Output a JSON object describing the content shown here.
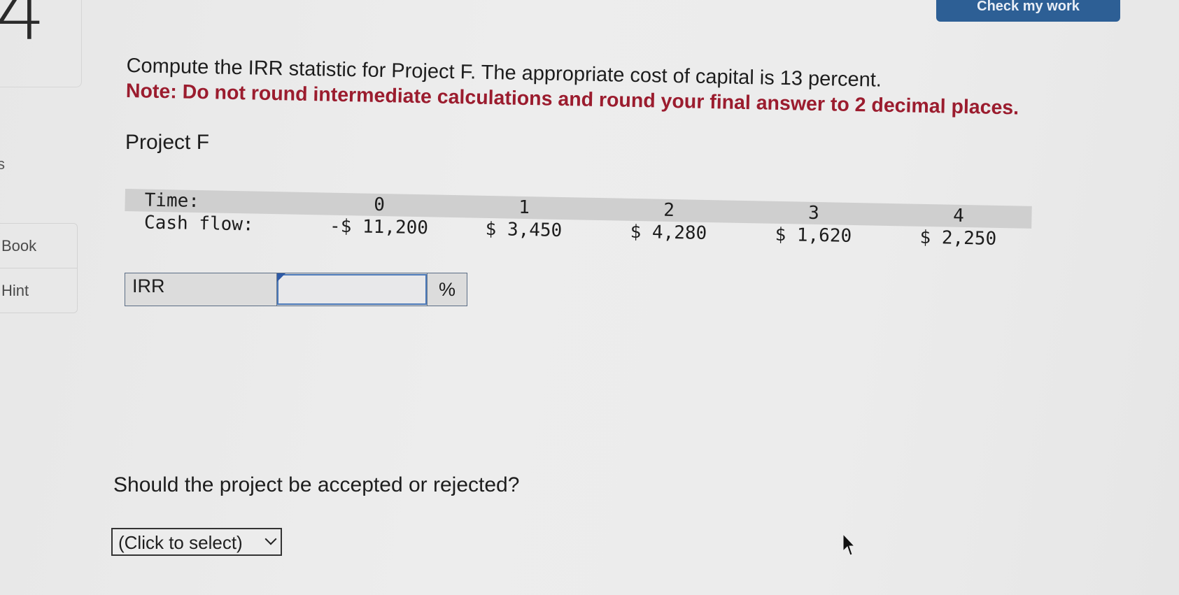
{
  "question_number": "4",
  "top_button_label": "Check my work",
  "sidebar": {
    "partial_label": "s",
    "tools": [
      {
        "label": "Book"
      },
      {
        "label": "Hint"
      }
    ]
  },
  "question": {
    "prompt": "Compute the IRR statistic for Project F. The appropriate cost of capital is 13 percent.",
    "note": "Note: Do not round intermediate calculations and round your final answer to 2 decimal places.",
    "project_label": "Project F"
  },
  "cash_flow_table": {
    "time_label": "Time:",
    "cash_flow_label": "Cash flow:",
    "times": [
      "0",
      "1",
      "2",
      "3",
      "4"
    ],
    "cash_flows": [
      "-$ 11,200",
      "$ 3,450",
      "$ 4,280",
      "$ 1,620",
      "$ 2,250"
    ]
  },
  "irr_input": {
    "label": "IRR",
    "value": "",
    "unit": "%"
  },
  "question2": {
    "prompt": "Should the project be accepted or rejected?",
    "select_value": "(Click to select)"
  }
}
